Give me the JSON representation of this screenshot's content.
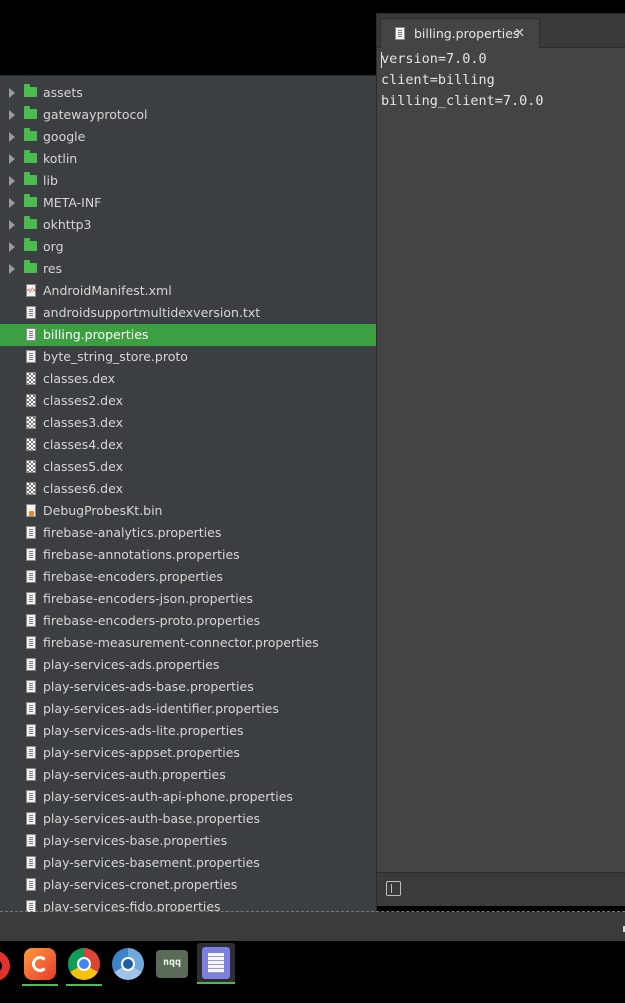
{
  "file_tree": {
    "items": [
      {
        "label": "assets",
        "type": "folder"
      },
      {
        "label": "gatewayprotocol",
        "type": "folder"
      },
      {
        "label": "google",
        "type": "folder"
      },
      {
        "label": "kotlin",
        "type": "folder"
      },
      {
        "label": "lib",
        "type": "folder"
      },
      {
        "label": "META-INF",
        "type": "folder"
      },
      {
        "label": "okhttp3",
        "type": "folder"
      },
      {
        "label": "org",
        "type": "folder"
      },
      {
        "label": "res",
        "type": "folder"
      },
      {
        "label": "AndroidManifest.xml",
        "type": "xml"
      },
      {
        "label": "androidsupportmultidexversion.txt",
        "type": "props"
      },
      {
        "label": "billing.properties",
        "type": "props",
        "selected": true
      },
      {
        "label": "byte_string_store.proto",
        "type": "props"
      },
      {
        "label": "classes.dex",
        "type": "dex"
      },
      {
        "label": "classes2.dex",
        "type": "dex"
      },
      {
        "label": "classes3.dex",
        "type": "dex"
      },
      {
        "label": "classes4.dex",
        "type": "dex"
      },
      {
        "label": "classes5.dex",
        "type": "dex"
      },
      {
        "label": "classes6.dex",
        "type": "dex"
      },
      {
        "label": "DebugProbesKt.bin",
        "type": "bin"
      },
      {
        "label": "firebase-analytics.properties",
        "type": "props"
      },
      {
        "label": "firebase-annotations.properties",
        "type": "props"
      },
      {
        "label": "firebase-encoders.properties",
        "type": "props"
      },
      {
        "label": "firebase-encoders-json.properties",
        "type": "props"
      },
      {
        "label": "firebase-encoders-proto.properties",
        "type": "props"
      },
      {
        "label": "firebase-measurement-connector.properties",
        "type": "props"
      },
      {
        "label": "play-services-ads.properties",
        "type": "props"
      },
      {
        "label": "play-services-ads-base.properties",
        "type": "props"
      },
      {
        "label": "play-services-ads-identifier.properties",
        "type": "props"
      },
      {
        "label": "play-services-ads-lite.properties",
        "type": "props"
      },
      {
        "label": "play-services-appset.properties",
        "type": "props"
      },
      {
        "label": "play-services-auth.properties",
        "type": "props"
      },
      {
        "label": "play-services-auth-api-phone.properties",
        "type": "props"
      },
      {
        "label": "play-services-auth-base.properties",
        "type": "props"
      },
      {
        "label": "play-services-base.properties",
        "type": "props"
      },
      {
        "label": "play-services-basement.properties",
        "type": "props"
      },
      {
        "label": "play-services-cronet.properties",
        "type": "props"
      },
      {
        "label": "play-services-fido.properties",
        "type": "props"
      }
    ]
  },
  "editor": {
    "tab_label": "billing.properties",
    "tab_close": "✕",
    "lines": [
      "version=7.0.0",
      "client=billing",
      "billing_client=7.0.0"
    ]
  },
  "taskbar": {
    "apps": [
      {
        "name": "partial-app-icon"
      },
      {
        "name": "firefox-icon"
      },
      {
        "name": "chrome-icon"
      },
      {
        "name": "chromium-icon"
      },
      {
        "name": "notepadqq-icon",
        "label": "nqq"
      },
      {
        "name": "text-editor-icon",
        "active": true
      }
    ]
  },
  "colors": {
    "selection": "#3ca043",
    "folder": "#4cbc50",
    "panel_bg": "#3c3f41",
    "editor_bg": "#444444"
  }
}
